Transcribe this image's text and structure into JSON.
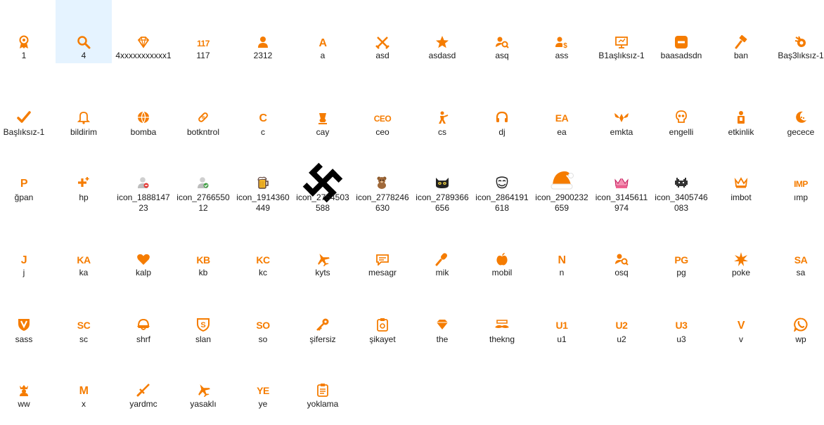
{
  "files": [
    {
      "name": "1",
      "icon": "award-icon"
    },
    {
      "name": "4",
      "icon": "magnifier-icon",
      "selected": true
    },
    {
      "name": "4xxxxxxxxxxx1",
      "icon": "diamond-icon"
    },
    {
      "name": "117",
      "icon": "text-badge-icon",
      "text": "117"
    },
    {
      "name": "2312",
      "icon": "user-icon"
    },
    {
      "name": "a",
      "icon": "text-badge-icon",
      "text": "A"
    },
    {
      "name": "asd",
      "icon": "crossed-swords-icon"
    },
    {
      "name": "asdasd",
      "icon": "star-icon"
    },
    {
      "name": "asq",
      "icon": "user-search-icon"
    },
    {
      "name": "ass",
      "icon": "user-s-icon"
    },
    {
      "name": "B1aşlıksız-1",
      "icon": "monitor-icon"
    },
    {
      "name": "baasadsdn",
      "icon": "block-icon"
    },
    {
      "name": "ban",
      "icon": "hammer-icon"
    },
    {
      "name": "Baş3lıksız-1",
      "icon": "fireball-icon"
    },
    {
      "name": "Başlıksız-1",
      "icon": "check-icon"
    },
    {
      "name": "bildirim",
      "icon": "bell-icon"
    },
    {
      "name": "bomba",
      "icon": "globe-icon"
    },
    {
      "name": "botkntrol",
      "icon": "bandage-icon"
    },
    {
      "name": "c",
      "icon": "text-badge-icon",
      "text": "C"
    },
    {
      "name": "cay",
      "icon": "tea-glass-icon"
    },
    {
      "name": "ceo",
      "icon": "text-badge-icon",
      "text": "CEO"
    },
    {
      "name": "cs",
      "icon": "soldier-icon"
    },
    {
      "name": "dj",
      "icon": "headphones-icon"
    },
    {
      "name": "ea",
      "icon": "text-badge-icon",
      "text": "EA"
    },
    {
      "name": "emkta",
      "icon": "winged-emblem-icon"
    },
    {
      "name": "engelli",
      "icon": "skull-icon"
    },
    {
      "name": "etkinlik",
      "icon": "person-badge-icon"
    },
    {
      "name": "gecece",
      "icon": "moon-icon"
    },
    {
      "name": "ğpan",
      "icon": "text-badge-icon",
      "text": "P"
    },
    {
      "name": "hp",
      "icon": "plus-icon"
    },
    {
      "name": "icon_188814723",
      "icon": "user-red-icon"
    },
    {
      "name": "icon_276655012",
      "icon": "user-green-icon"
    },
    {
      "name": "icon_1914360449",
      "icon": "beer-mug-icon"
    },
    {
      "name": "icon_2754503588",
      "icon": "swastika-icon"
    },
    {
      "name": "icon_2778246630",
      "icon": "teddy-bear-icon"
    },
    {
      "name": "icon_2789366656",
      "icon": "cat-face-icon"
    },
    {
      "name": "icon_2864191618",
      "icon": "troll-face-icon"
    },
    {
      "name": "icon_2900232659",
      "icon": "santa-hat-icon"
    },
    {
      "name": "icon_3145611974",
      "icon": "pink-crown-icon"
    },
    {
      "name": "icon_3405746083",
      "icon": "space-invader-icon"
    },
    {
      "name": "imbot",
      "icon": "crown-icon"
    },
    {
      "name": "ımp",
      "icon": "text-badge-icon",
      "text": "IMP"
    },
    {
      "name": "j",
      "icon": "text-badge-icon",
      "text": "J"
    },
    {
      "name": "ka",
      "icon": "text-badge-icon",
      "text": "KA"
    },
    {
      "name": "kalp",
      "icon": "heart-icon"
    },
    {
      "name": "kb",
      "icon": "text-badge-icon",
      "text": "KB"
    },
    {
      "name": "kc",
      "icon": "text-badge-icon",
      "text": "KC"
    },
    {
      "name": "kyts",
      "icon": "airplane-icon"
    },
    {
      "name": "mesagr",
      "icon": "message-icon"
    },
    {
      "name": "mik",
      "icon": "microphone-icon"
    },
    {
      "name": "mobil",
      "icon": "apple-icon"
    },
    {
      "name": "n",
      "icon": "text-badge-icon",
      "text": "N"
    },
    {
      "name": "osq",
      "icon": "user-search-icon"
    },
    {
      "name": "pg",
      "icon": "text-badge-icon",
      "text": "PG"
    },
    {
      "name": "poke",
      "icon": "burst-icon"
    },
    {
      "name": "sa",
      "icon": "text-badge-icon",
      "text": "SA"
    },
    {
      "name": "sass",
      "icon": "shield-v-icon"
    },
    {
      "name": "sc",
      "icon": "text-badge-icon",
      "text": "SC"
    },
    {
      "name": "shrf",
      "icon": "helmet-icon"
    },
    {
      "name": "slan",
      "icon": "shield-s-icon"
    },
    {
      "name": "so",
      "icon": "text-badge-icon",
      "text": "SO"
    },
    {
      "name": "şifersiz",
      "icon": "key-icon"
    },
    {
      "name": "şikayet",
      "icon": "clipboard-icon"
    },
    {
      "name": "the",
      "icon": "gem-icon"
    },
    {
      "name": "thekng",
      "icon": "mustache-icon"
    },
    {
      "name": "u1",
      "icon": "text-badge-icon",
      "text": "U1"
    },
    {
      "name": "u2",
      "icon": "text-badge-icon",
      "text": "U2"
    },
    {
      "name": "u3",
      "icon": "text-badge-icon",
      "text": "U3"
    },
    {
      "name": "v",
      "icon": "text-badge-icon",
      "text": "V"
    },
    {
      "name": "wp",
      "icon": "whatsapp-icon"
    },
    {
      "name": "ww",
      "icon": "king-icon"
    },
    {
      "name": "x",
      "icon": "text-badge-icon",
      "text": "M"
    },
    {
      "name": "yardmc",
      "icon": "sword-icon"
    },
    {
      "name": "yasaklı",
      "icon": "airplane-icon"
    },
    {
      "name": "ye",
      "icon": "text-badge-icon",
      "text": "YE"
    },
    {
      "name": "yoklama",
      "icon": "clipboard-list-icon"
    }
  ],
  "colors": {
    "accent": "#f57c00",
    "selection": "#e5f3ff",
    "text": "#1a1a1a"
  }
}
